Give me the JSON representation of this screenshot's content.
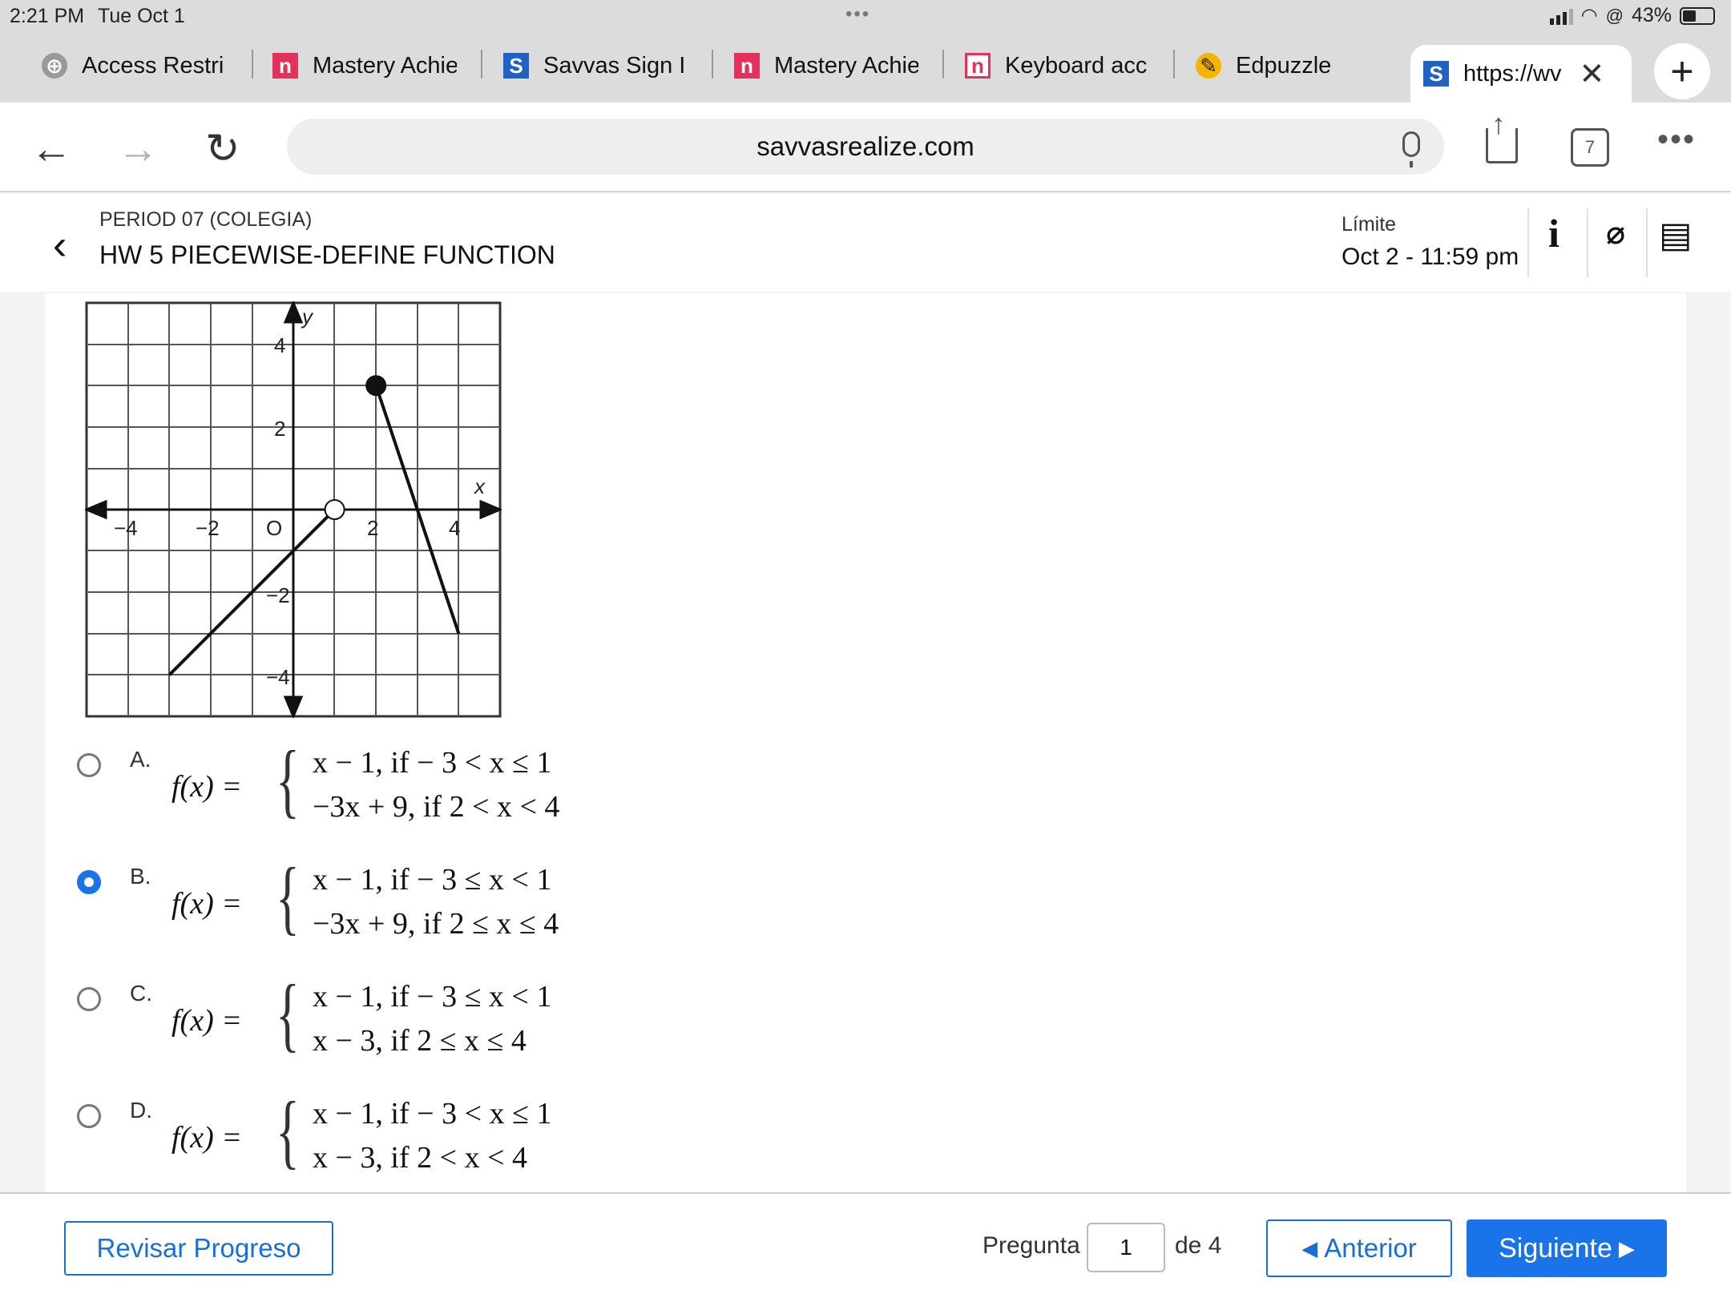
{
  "status": {
    "time": "2:21 PM",
    "date": "Tue Oct 1",
    "battery": "43%"
  },
  "tabs": [
    {
      "label": "Access Restri",
      "icon": "globe-icon"
    },
    {
      "label": "Mastery Achie",
      "icon": "n-icon"
    },
    {
      "label": "Savvas Sign I",
      "icon": "savvas-icon"
    },
    {
      "label": "Mastery Achie",
      "icon": "n-icon"
    },
    {
      "label": "Keyboard acc",
      "icon": "n-outline-icon"
    },
    {
      "label": "Edpuzzle",
      "icon": "edpuzzle-icon"
    },
    {
      "label": "https://wv",
      "icon": "savvas-icon",
      "active": true
    }
  ],
  "browser": {
    "url": "savvasrealize.com",
    "tab_count": "7"
  },
  "header": {
    "period": "PERIOD 07 (COLEGIA)",
    "title": "HW 5 PIECEWISE-DEFINE FUNCTION",
    "due_label": "Límite",
    "due_value": "Oct 2 - 11:59 pm"
  },
  "graph": {
    "x_label": "x",
    "y_label": "y",
    "x_ticks": [
      "−4",
      "−2",
      "O",
      "2",
      "4"
    ],
    "y_ticks": [
      "4",
      "2",
      "−2",
      "−4"
    ],
    "segments": [
      {
        "from": [
          -3,
          -4
        ],
        "to": [
          1,
          0
        ],
        "start": "none",
        "end": "open"
      },
      {
        "from": [
          2,
          3
        ],
        "to": [
          4,
          -3
        ],
        "start": "closed",
        "end": "none"
      }
    ]
  },
  "options": [
    {
      "letter": "A.",
      "fx": "f(x) =",
      "case1": "x − 1, if  − 3 < x ≤ 1",
      "case2": "−3x + 9,  if 2 < x < 4",
      "selected": false
    },
    {
      "letter": "B.",
      "fx": "f(x) =",
      "case1": "x − 1, if  − 3 ≤ x < 1",
      "case2": "−3x + 9,  if 2 ≤ x ≤ 4",
      "selected": true
    },
    {
      "letter": "C.",
      "fx": "f(x) =",
      "case1": "x − 1, if  − 3 ≤ x < 1",
      "case2": "x − 3,  if 2 ≤ x ≤ 4",
      "selected": false
    },
    {
      "letter": "D.",
      "fx": "f(x) =",
      "case1": "x − 1, if  − 3 < x ≤ 1",
      "case2": "x − 3,  if 2 < x < 4",
      "selected": false
    }
  ],
  "footer": {
    "review_label": "Revisar Progreso",
    "question_label": "Pregunta",
    "question_value": "1",
    "of_label": "de 4",
    "prev_label": "Anterior",
    "next_label": "Siguiente"
  },
  "colors": {
    "accent": "#1a73e8",
    "chrome": "#dcdcdc"
  }
}
